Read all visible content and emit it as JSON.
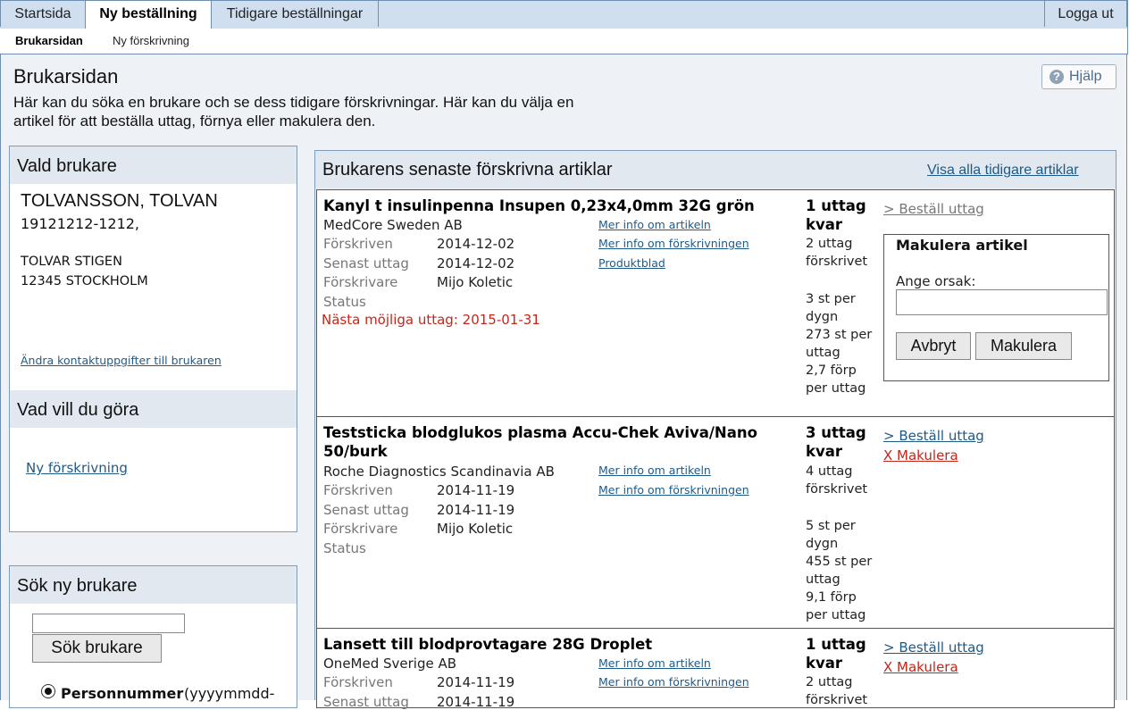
{
  "nav": {
    "tabs": [
      "Startsida",
      "Ny beställning",
      "Tidigare beställningar"
    ],
    "logout": "Logga ut",
    "subnav": [
      "Brukarsidan",
      "Ny förskrivning"
    ]
  },
  "page": {
    "title": "Brukarsidan",
    "intro": "Här kan du söka en brukare och se dess tidigare förskrivningar. Här kan du välja en artikel för att beställa uttag, förnya eller makulera den.",
    "help": "Hjälp"
  },
  "selected_user": {
    "heading": "Vald brukare",
    "name": "TOLVANSSON, TOLVAN",
    "pnr": "19121212-1212,",
    "street": "TOLVAR STIGEN",
    "city": "12345 STOCKHOLM",
    "edit_link": "Ändra kontaktuppgifter till brukaren"
  },
  "actions_panel": {
    "heading": "Vad vill du göra",
    "new_prescription": "Ny förskrivning"
  },
  "search": {
    "heading": "Sök ny brukare",
    "value": "",
    "button": "Sök brukare",
    "radio_label": "Personnummer",
    "radio_hint": "(yyyymmdd-"
  },
  "articles": {
    "heading": "Brukarens senaste förskrivna artiklar",
    "show_all": "Visa alla tidigare artiklar",
    "labels": {
      "prescribed": "Förskriven",
      "last_withdrawal": "Senast uttag",
      "prescriber": "Förskrivare",
      "status": "Status"
    },
    "items": [
      {
        "title": "Kanyl t insulinpenna Insupen 0,23x4,0mm 32G grön",
        "supplier": "MedCore Sweden AB",
        "prescribed": "2014-12-02",
        "last_withdrawal": "2014-12-02",
        "prescriber": "Mijo Koletic",
        "next_possible": "Nästa möjliga uttag: 2015-01-31",
        "links": [
          "Mer info om artikeln",
          "Mer info om förskrivningen",
          "Produktblad"
        ],
        "remaining": "1 uttag kvar",
        "prescribed_count": "2 uttag förskrivet",
        "per_day": "3 st per dygn",
        "per_withdrawal": "273 st per uttag",
        "packs": "2,7 förp per uttag",
        "order": "> Beställ uttag",
        "cancel_box": {
          "title": "Makulera artikel",
          "reason_label": "Ange orsak:",
          "reason_value": "",
          "abort": "Avbryt",
          "confirm": "Makulera"
        }
      },
      {
        "title": "Teststicka blodglukos plasma Accu-Chek Aviva/Nano 50/burk",
        "supplier": "Roche Diagnostics Scandinavia AB",
        "prescribed": "2014-11-19",
        "last_withdrawal": "2014-11-19",
        "prescriber": "Mijo Koletic",
        "links": [
          "Mer info om artikeln",
          "Mer info om förskrivningen"
        ],
        "remaining": "3 uttag kvar",
        "prescribed_count": "4 uttag förskrivet",
        "per_day": "5 st per dygn",
        "per_withdrawal": "455 st per uttag",
        "packs": "9,1 förp per uttag",
        "order": "> Beställ uttag",
        "cancel": "X Makulera"
      },
      {
        "title": "Lansett till blodprovtagare 28G Droplet",
        "supplier": "OneMed Sverige AB",
        "prescribed": "2014-11-19",
        "last_withdrawal": "2014-11-19",
        "links": [
          "Mer info om artikeln",
          "Mer info om förskrivningen"
        ],
        "remaining": "1 uttag kvar",
        "prescribed_count": "2 uttag förskrivet",
        "order": "> Beställ uttag",
        "cancel": "X Makulera"
      }
    ]
  }
}
